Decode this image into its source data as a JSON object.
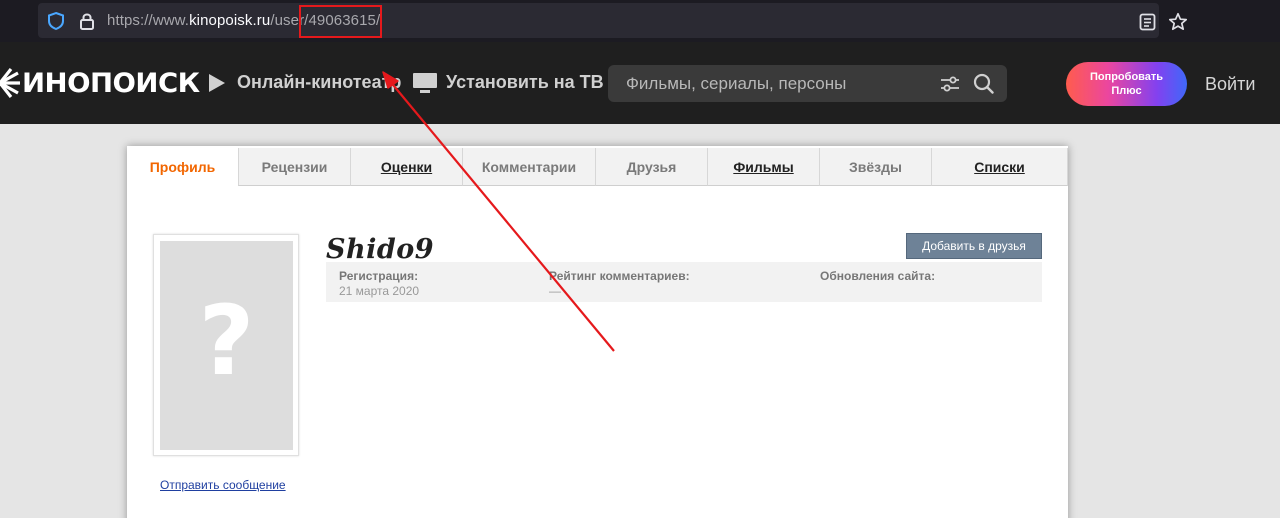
{
  "browser": {
    "url_prefix": "https://www.",
    "url_host": "kinopoisk.ru",
    "url_path": "/user/",
    "url_user_id": "49063615/"
  },
  "header": {
    "logo_text": "ИНОПОИСК",
    "nav_online": "Онлайн-кинотеатр",
    "nav_tv": "Установить на ТВ",
    "search_placeholder": "Фильмы, сериалы, персоны",
    "plus_button": "Попробовать Плюс",
    "login": "Войти",
    "plus_gradient": [
      "#ff5c4d",
      "#eb469f",
      "#8341ef",
      "#3f68f9"
    ]
  },
  "tabs": [
    {
      "label": "Профиль",
      "active": true
    },
    {
      "label": "Рецензии"
    },
    {
      "label": "Оценки",
      "underlined": true
    },
    {
      "label": "Комментарии"
    },
    {
      "label": "Друзья"
    },
    {
      "label": "Фильмы",
      "underlined": true
    },
    {
      "label": "Звёзды"
    },
    {
      "label": "Списки",
      "underlined": true
    }
  ],
  "profile": {
    "username": "Shido9",
    "add_friend_label": "Добавить в друзья",
    "send_message_label": "Отправить сообщение",
    "avatar_placeholder": "?",
    "registration_label": "Регистрация:",
    "registration_value": "21 марта 2020",
    "rating_label": "Рейтинг комментариев:",
    "rating_value": "—",
    "updates_label": "Обновления сайта:"
  },
  "colors": {
    "active_tab": "#f26600",
    "highlight": "#e5191c",
    "header_bg": "#1f1f1f",
    "add_friend_bg": "#6e8297"
  }
}
